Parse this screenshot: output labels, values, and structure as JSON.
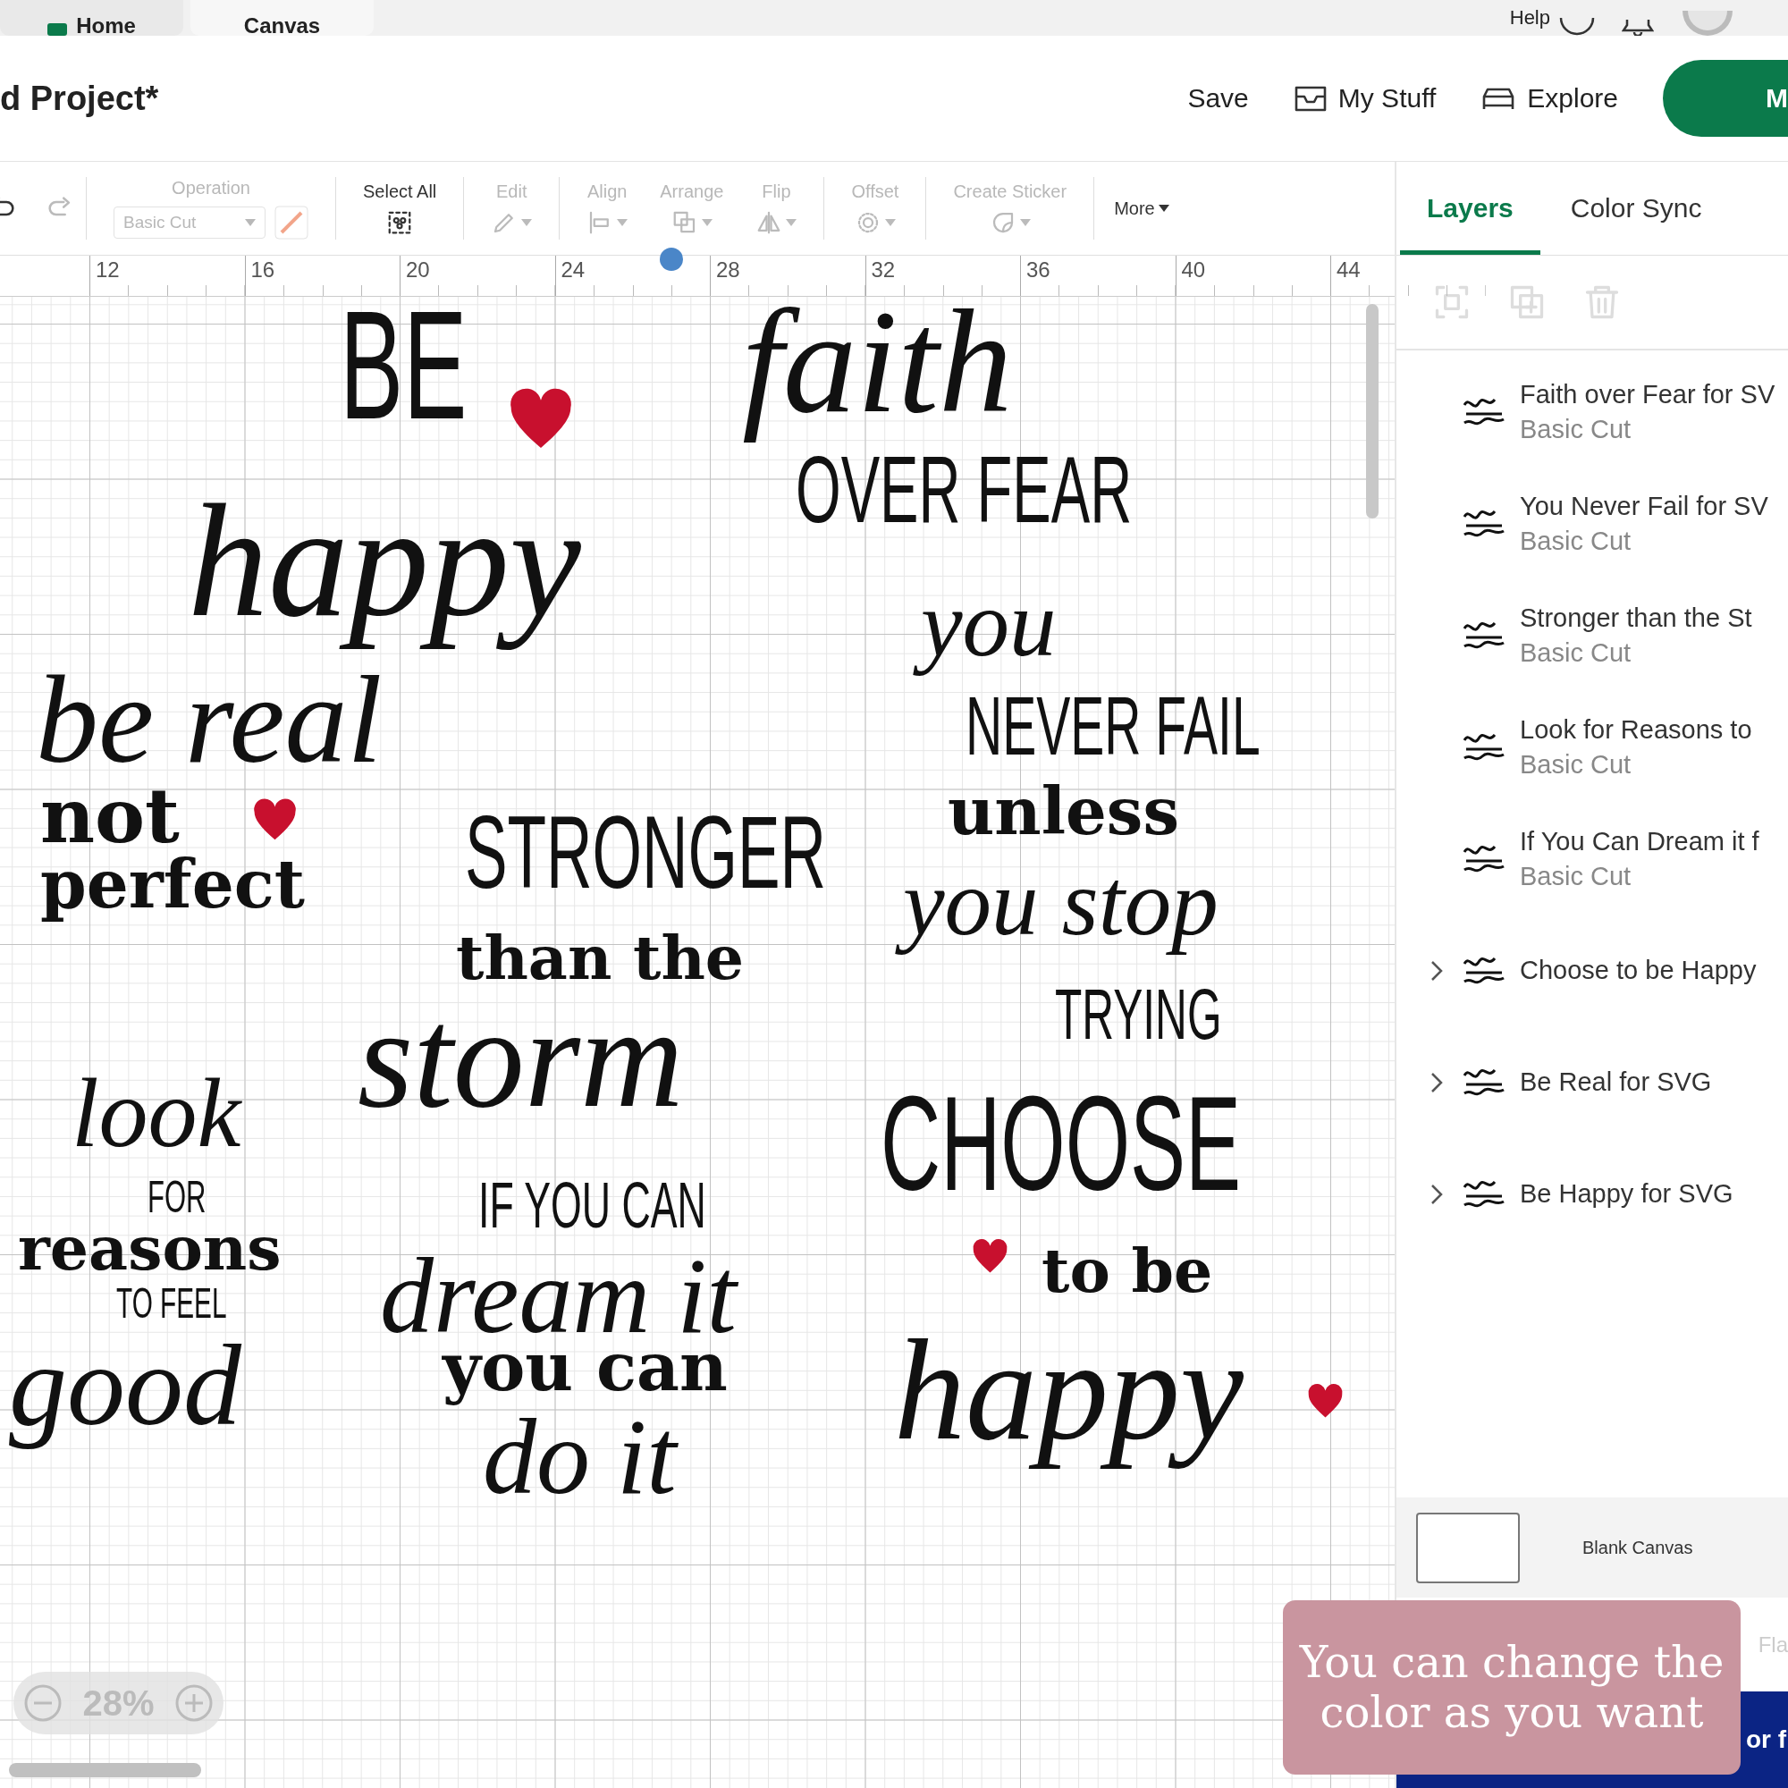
{
  "top_tabs": [
    {
      "label": "Home",
      "selected": false
    },
    {
      "label": "Canvas",
      "selected": true
    }
  ],
  "top_right": {
    "help": "Help"
  },
  "header": {
    "project_title": "d Project*",
    "actions": [
      {
        "label": "Save",
        "kind": "plain"
      },
      {
        "label": "My Stuff",
        "kind": "stuff"
      },
      {
        "label": "Explore",
        "kind": "explore"
      }
    ],
    "make_button": "M"
  },
  "toolbar": [
    {
      "kind": "undo",
      "disabled": false
    },
    {
      "kind": "redo",
      "disabled": true
    },
    {
      "kind": "operation",
      "label": "Operation",
      "value": "Basic Cut",
      "disabled": true
    },
    {
      "kind": "select_all",
      "label": "Select All",
      "disabled": false
    },
    {
      "kind": "edit",
      "label": "Edit",
      "disabled": true
    },
    {
      "kind": "align",
      "label": "Align",
      "disabled": true
    },
    {
      "kind": "arrange",
      "label": "Arrange",
      "disabled": true
    },
    {
      "kind": "flip",
      "label": "Flip",
      "disabled": true
    },
    {
      "kind": "offset",
      "label": "Offset",
      "disabled": true
    },
    {
      "kind": "sticker",
      "label": "Create Sticker",
      "disabled": true
    },
    {
      "kind": "more",
      "label": "More",
      "disabled": false
    }
  ],
  "ruler": [
    "12",
    "16",
    "20",
    "24",
    "28",
    "32",
    "36",
    "40",
    "44"
  ],
  "designs": [
    {
      "lines": [
        {
          "text": "BE",
          "kind": "condensed"
        },
        {
          "text": "happy",
          "kind": "script"
        }
      ]
    },
    {
      "lines": [
        {
          "text": "faith",
          "kind": "script"
        },
        {
          "text": "OVER FEAR",
          "kind": "condensed"
        }
      ]
    },
    {
      "lines": [
        {
          "text": "be real",
          "kind": "script"
        },
        {
          "text": "not",
          "kind": "slab"
        },
        {
          "text": "perfect",
          "kind": "slab"
        }
      ]
    },
    {
      "lines": [
        {
          "text": "STRONGER",
          "kind": "condensed"
        },
        {
          "text": "than the",
          "kind": "slab"
        },
        {
          "text": "storm",
          "kind": "script"
        }
      ]
    },
    {
      "lines": [
        {
          "text": "you",
          "kind": "script"
        },
        {
          "text": "NEVER FAIL",
          "kind": "condensed"
        },
        {
          "text": "unless",
          "kind": "slab"
        },
        {
          "text": "you stop",
          "kind": "script"
        },
        {
          "text": "TRYING",
          "kind": "condensed"
        }
      ]
    },
    {
      "lines": [
        {
          "text": "look",
          "kind": "script"
        },
        {
          "text": "FOR",
          "kind": "condensed"
        },
        {
          "text": "reasons",
          "kind": "slab"
        },
        {
          "text": "TO FEEL",
          "kind": "condensed"
        },
        {
          "text": "good",
          "kind": "script"
        }
      ]
    },
    {
      "lines": [
        {
          "text": "IF YOU CAN",
          "kind": "condensed"
        },
        {
          "text": "dream it",
          "kind": "script"
        },
        {
          "text": "you can",
          "kind": "slab"
        },
        {
          "text": "do it",
          "kind": "script"
        }
      ]
    },
    {
      "lines": [
        {
          "text": "CHOOSE",
          "kind": "condensed"
        },
        {
          "text": "to be",
          "kind": "slab"
        },
        {
          "text": "happy",
          "kind": "script"
        }
      ]
    }
  ],
  "zoom": {
    "value": "28%"
  },
  "panel": {
    "tabs": [
      {
        "label": "Layers",
        "selected": true
      },
      {
        "label": "Color Sync",
        "selected": false
      }
    ],
    "layers": [
      {
        "name": "Faith over Fear for SV",
        "operation": "Basic Cut",
        "expandable": false
      },
      {
        "name": "You Never Fail for SV",
        "operation": "Basic Cut",
        "expandable": false
      },
      {
        "name": "Stronger than the St",
        "operation": "Basic Cut",
        "expandable": false
      },
      {
        "name": "Look for Reasons to",
        "operation": "Basic Cut",
        "expandable": false
      },
      {
        "name": "If You Can Dream it f",
        "operation": "Basic Cut",
        "expandable": false
      },
      {
        "name": "Choose to be Happy",
        "expandable": true
      },
      {
        "name": "Be Real for SVG",
        "expandable": true
      },
      {
        "name": "Be Happy for SVG",
        "expandable": true
      }
    ],
    "blank_canvas": "Blank Canvas",
    "bottom_tab": "Fla",
    "banner_text": "or f"
  },
  "caption": "You can change the color as you want"
}
